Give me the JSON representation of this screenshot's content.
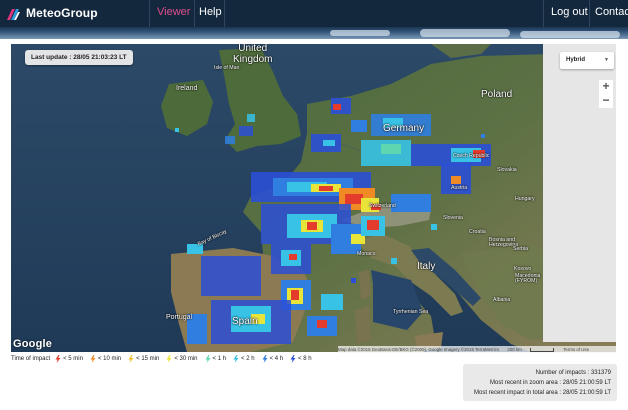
{
  "nav": {
    "brand": "MeteoGroup",
    "links": [
      {
        "label": "Viewer",
        "active": true
      },
      {
        "label": "Help",
        "active": false
      },
      {
        "label": "Log out",
        "active": false
      },
      {
        "label": "Contact",
        "active": false
      }
    ]
  },
  "map": {
    "last_update": "Last update : 28/05 21:03:23 LT",
    "map_type": "Hybrid",
    "zoom_in": "+",
    "zoom_out": "−",
    "google": "Google",
    "attribution": "Map data ©2016 GeoBasis-DE/BKG (©2009), Google Imagery ©2016 TerraMetrics",
    "scale": "200 km",
    "terms": "Terms of Use",
    "labels": {
      "united_kingdom": "United\nKingdom",
      "isle_of_man": "Isle of Man",
      "ireland": "Ireland",
      "germany": "Germany",
      "poland": "Poland",
      "czechia": "Czech Republic",
      "slovakia": "Slovakia",
      "austria": "Austria",
      "hungary": "Hungary",
      "switzerland": "Switzerland",
      "slovenia": "Slovenia",
      "croatia": "Croatia",
      "bosnia": "Bosnia and\nHerzegovina",
      "serbia": "Serbia",
      "monaco": "Monaco",
      "italy": "Italy",
      "kosovo": "Kosovo",
      "macedonia": "Macedonia\n(FYROM)",
      "albania": "Albania",
      "portugal": "Portugal",
      "spain": "Spain",
      "bay_of_biscay": "Bay of Biscay",
      "tyrrhenian": "Tyrrhenian Sea"
    }
  },
  "legend": {
    "title": "Time of impact",
    "items": [
      {
        "label": "< 5 min",
        "color": "#e53b2c"
      },
      {
        "label": "< 10 min",
        "color": "#f08a24"
      },
      {
        "label": "< 15 min",
        "color": "#f2c12e"
      },
      {
        "label": "< 30 min",
        "color": "#e9e43a"
      },
      {
        "label": "< 1 h",
        "color": "#5ed6b0"
      },
      {
        "label": "< 2 h",
        "color": "#37c2e6"
      },
      {
        "label": "< 4 h",
        "color": "#2f7ee0"
      },
      {
        "label": "< 8 h",
        "color": "#2b4fd6"
      }
    ]
  },
  "info": {
    "impacts_label": "Number of impacts :",
    "impacts_value": "331379",
    "zoom_label": "Most recent in zoom area :",
    "zoom_value": "28/05 21:00:59 LT",
    "total_label": "Most recent impact in total area :",
    "total_value": "28/05 21:00:59 LT"
  }
}
